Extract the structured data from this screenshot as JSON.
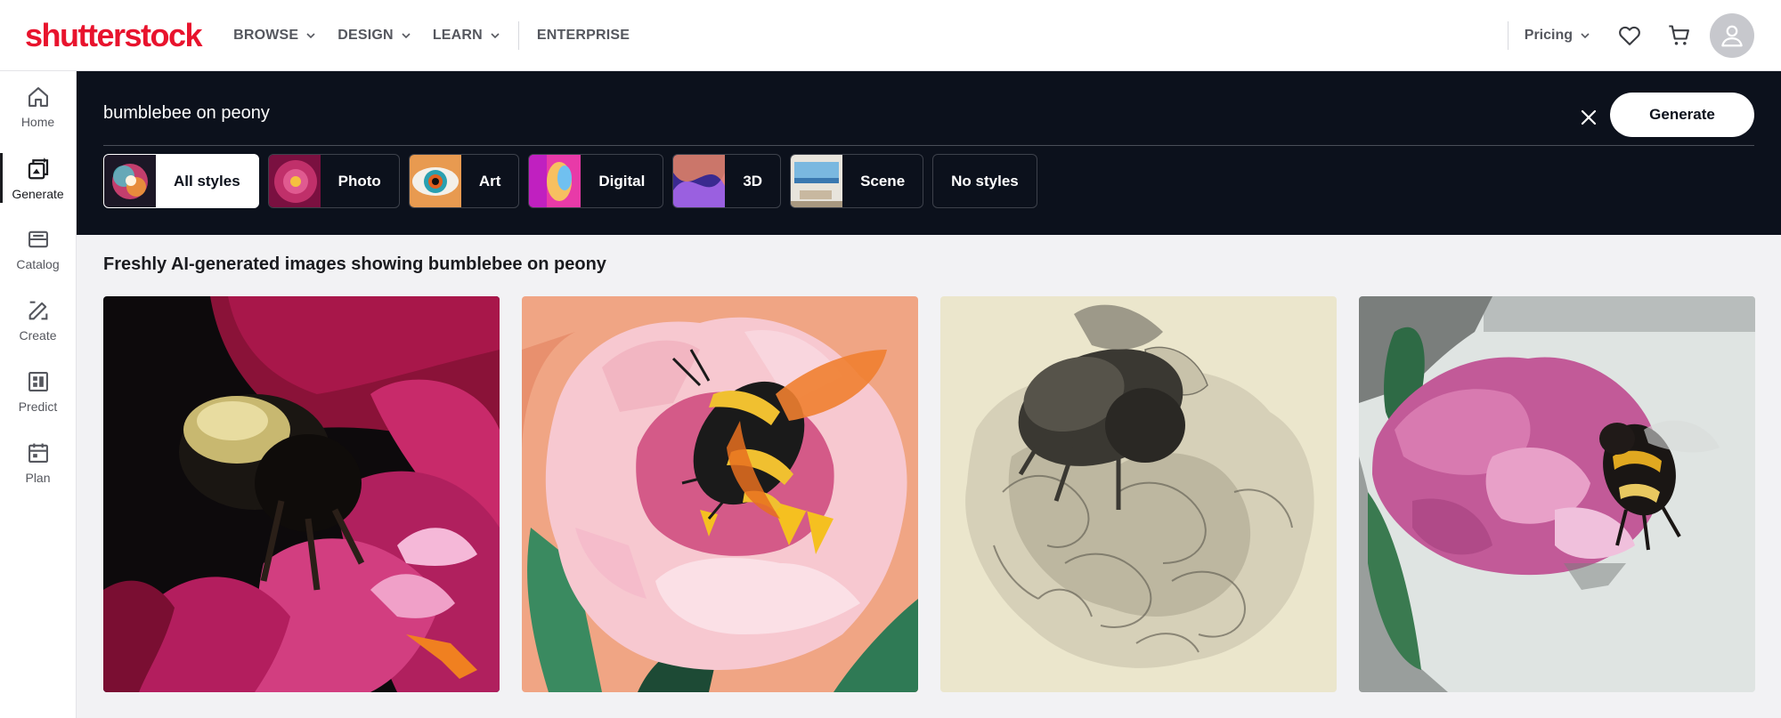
{
  "brand": {
    "logo_text": "shutterstock",
    "color": "#e8132d"
  },
  "topnav": {
    "items": [
      {
        "label": "BROWSE",
        "dropdown": true
      },
      {
        "label": "DESIGN",
        "dropdown": true
      },
      {
        "label": "LEARN",
        "dropdown": true
      },
      {
        "label": "ENTERPRISE",
        "dropdown": false
      }
    ],
    "pricing_label": "Pricing",
    "icons": [
      "heart-icon",
      "cart-icon",
      "user-icon"
    ]
  },
  "sidebar": {
    "items": [
      {
        "label": "Home",
        "icon": "home-icon",
        "active": false
      },
      {
        "label": "Generate",
        "icon": "generate-icon",
        "active": true
      },
      {
        "label": "Catalog",
        "icon": "catalog-icon",
        "active": false
      },
      {
        "label": "Create",
        "icon": "create-icon",
        "active": false
      },
      {
        "label": "Predict",
        "icon": "predict-icon",
        "active": false
      },
      {
        "label": "Plan",
        "icon": "plan-icon",
        "active": false
      }
    ]
  },
  "search": {
    "value": "bumblebee on peony",
    "generate_label": "Generate"
  },
  "styles": [
    {
      "label": "All styles",
      "active": true
    },
    {
      "label": "Photo",
      "active": false
    },
    {
      "label": "Art",
      "active": false
    },
    {
      "label": "Digital",
      "active": false
    },
    {
      "label": "3D",
      "active": false
    },
    {
      "label": "Scene",
      "active": false
    },
    {
      "label": "No styles",
      "active": false
    }
  ],
  "results": {
    "title": "Freshly AI-generated images showing bumblebee on peony",
    "images": [
      {
        "name": "dark-photo-bee-on-magenta-peony"
      },
      {
        "name": "illustration-bee-on-pink-peony"
      },
      {
        "name": "pencil-sketch-bee-on-peony"
      },
      {
        "name": "photo-bee-on-pink-peony-white-background"
      }
    ]
  }
}
